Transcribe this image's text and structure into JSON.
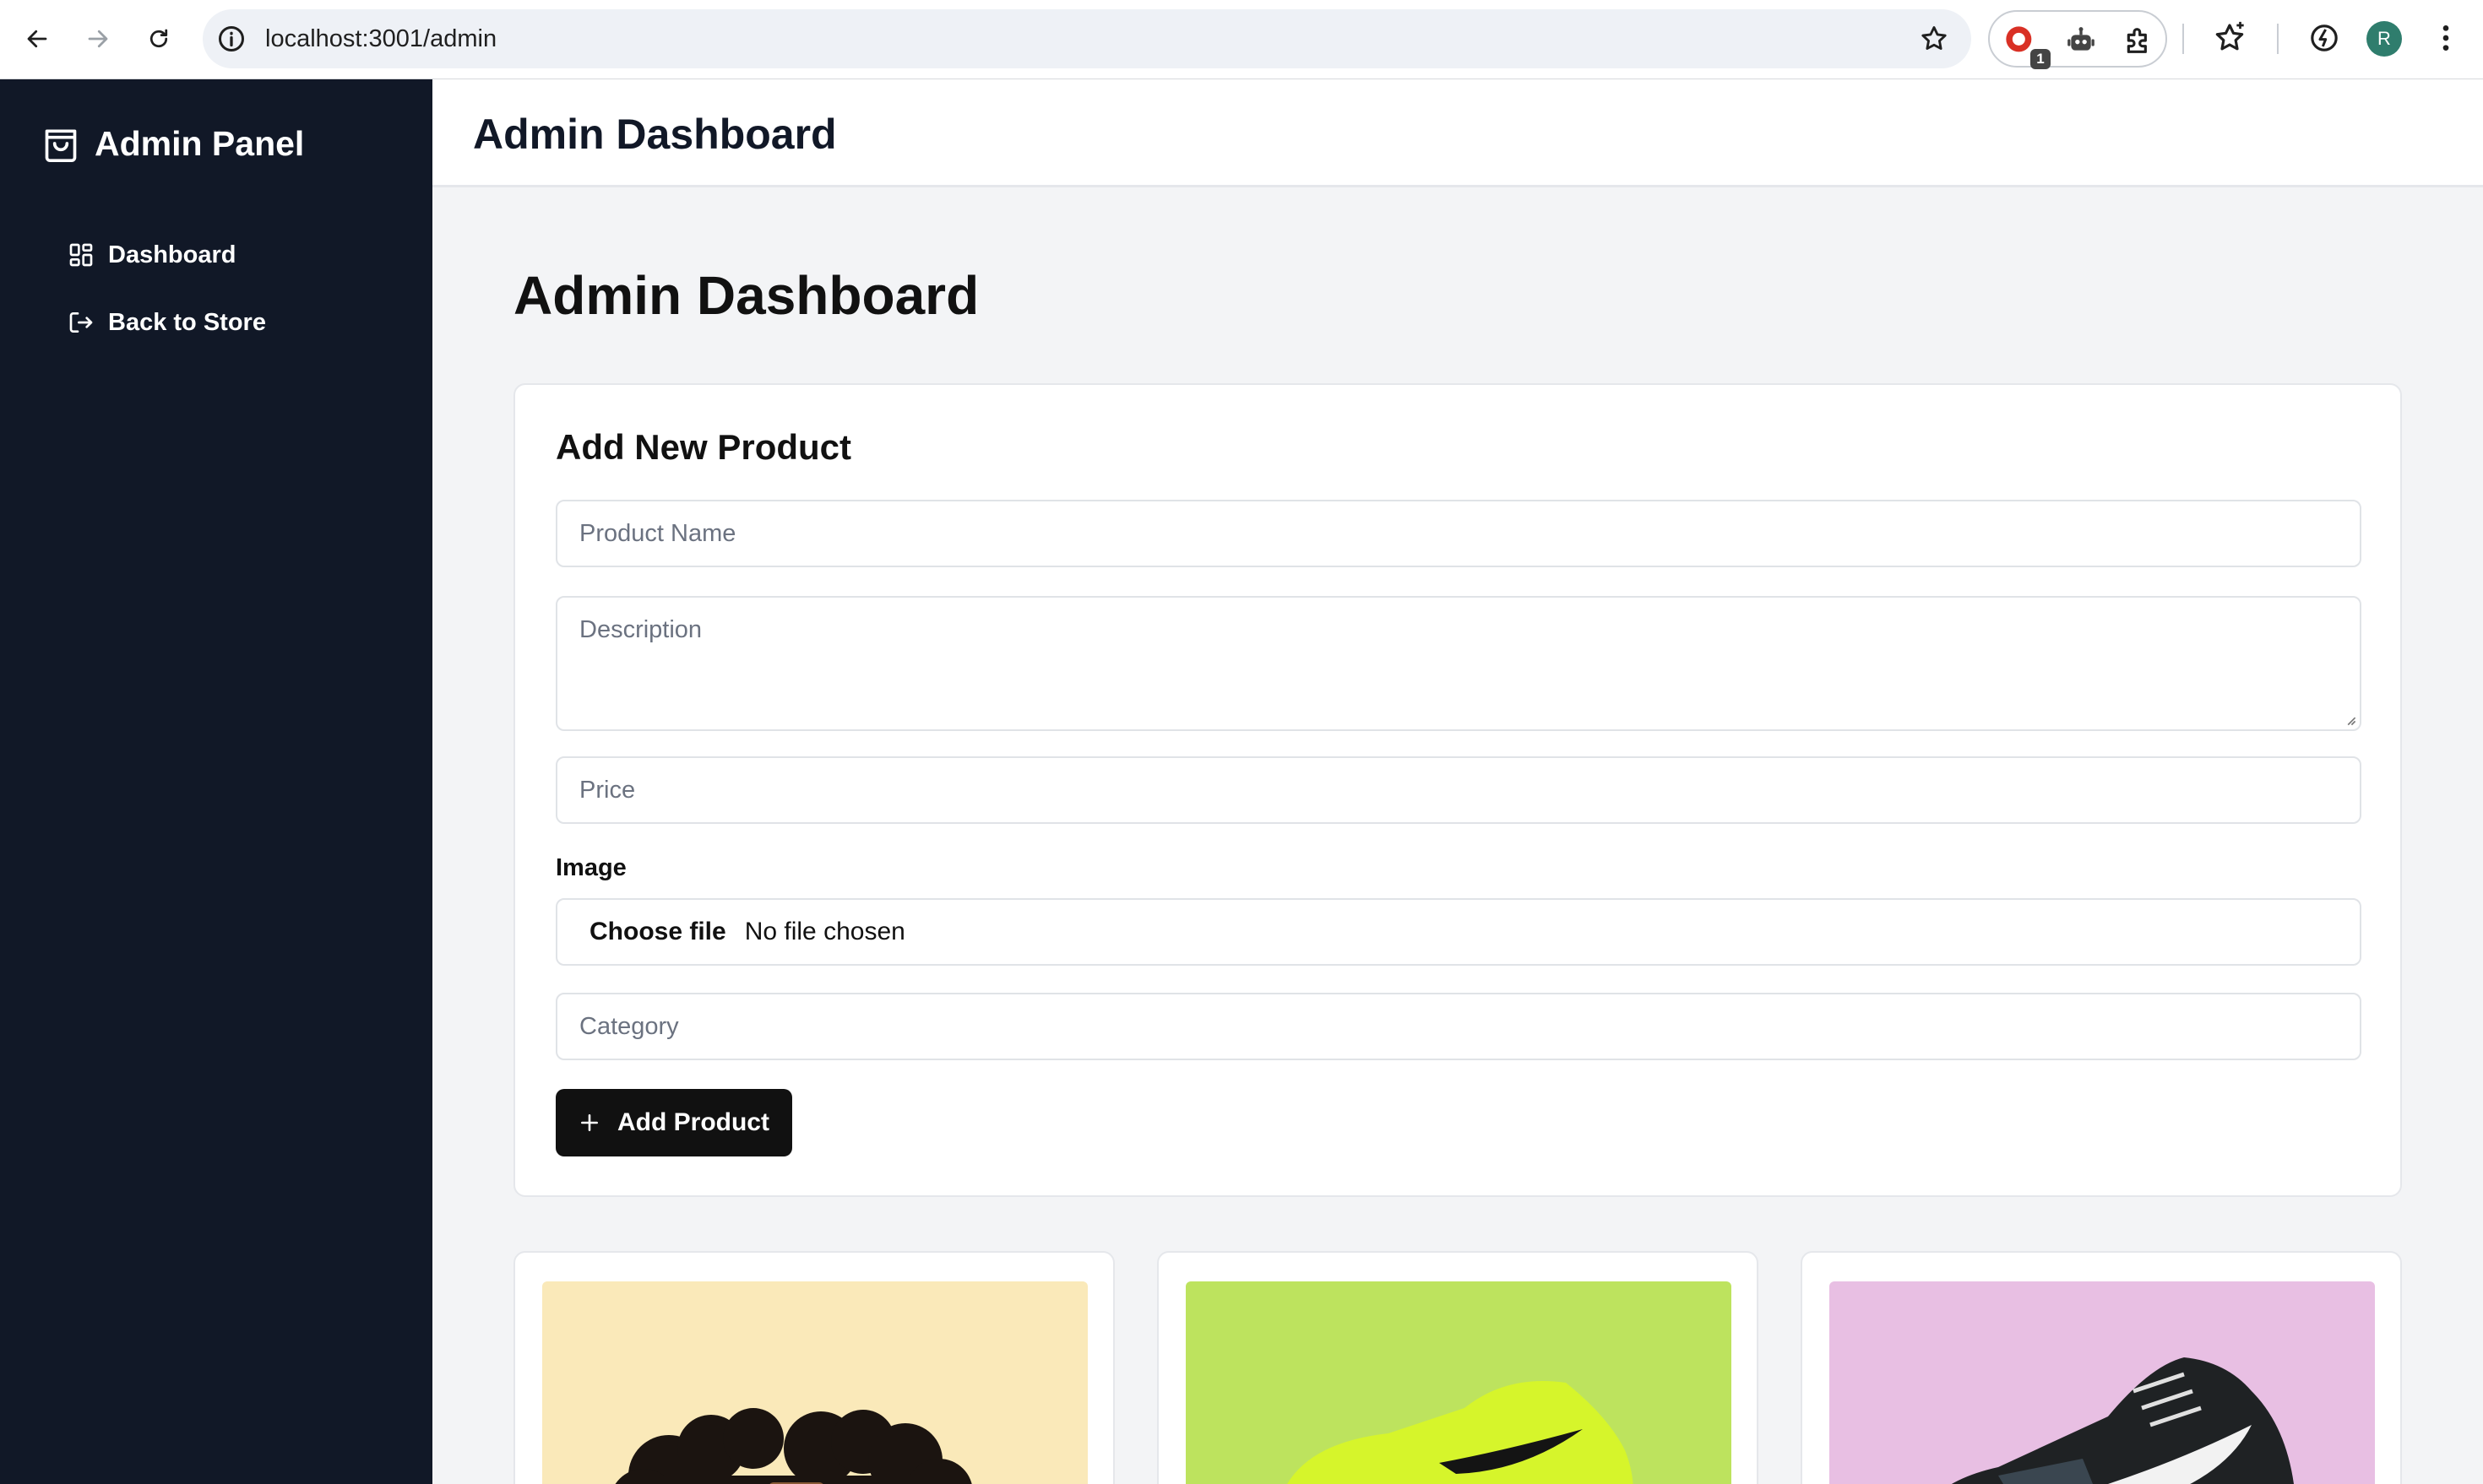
{
  "browser": {
    "url": "localhost:3001/admin",
    "extension_badge": "1",
    "profile_initial": "R"
  },
  "sidebar": {
    "brand": "Admin Panel",
    "items": [
      {
        "label": "Dashboard",
        "icon": "grid-icon"
      },
      {
        "label": "Back to Store",
        "icon": "logout-icon"
      }
    ]
  },
  "header": {
    "title": "Admin Dashboard"
  },
  "main": {
    "title": "Admin Dashboard",
    "form": {
      "heading": "Add New Product",
      "name_placeholder": "Product Name",
      "description_placeholder": "Description",
      "price_placeholder": "Price",
      "image_label": "Image",
      "file_button": "Choose file",
      "file_status": "No file chosen",
      "category_placeholder": "Category",
      "submit_label": "Add Product"
    },
    "products": [
      {
        "image": "character-with-curly-hair",
        "bg": "#fae9b9"
      },
      {
        "image": "neon-green-sneaker",
        "bg": "#bde35e"
      },
      {
        "image": "black-white-sneaker",
        "bg": "#e8bfe3"
      }
    ]
  },
  "colors": {
    "sidebar_bg": "#111827",
    "page_bg": "#f3f4f6",
    "button_bg": "#111111"
  }
}
